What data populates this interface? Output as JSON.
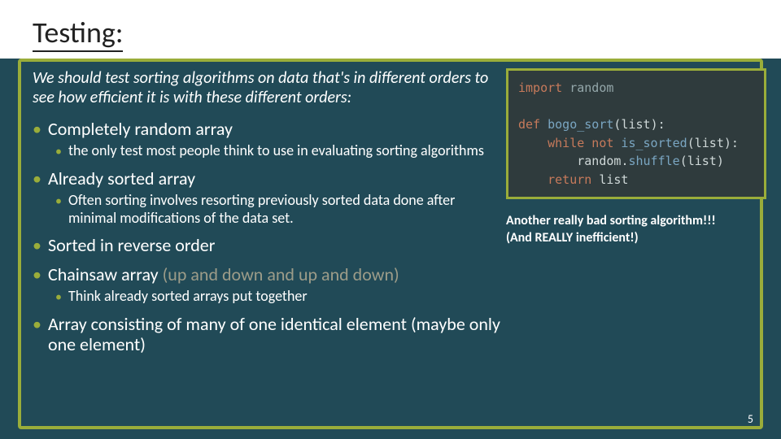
{
  "title": "Testing:",
  "intro": "We should test sorting algorithms on data that's in different orders to see how efficient it is with these different orders:",
  "bullets": [
    {
      "text": "Completely random array",
      "sub": [
        "the only test most people think to use in evaluating sorting algorithms"
      ]
    },
    {
      "text": "Already sorted array",
      "sub": [
        "Often sorting involves resorting previously sorted data done after minimal modifications of the data set."
      ]
    },
    {
      "text": "Sorted in reverse order",
      "sub": []
    },
    {
      "text": "Chainsaw array",
      "suffix": " (up and down and up and down)",
      "sub": [
        "Think already sorted arrays put together"
      ]
    },
    {
      "text": "Array consisting of many of one identical element (maybe only one element)",
      "sub": []
    }
  ],
  "code": {
    "l1a": "import",
    "l1b": " random",
    "l2a": "def",
    "l2b": " bogo_sort",
    "l2c": "(",
    "l2d": "list",
    "l2e": "):",
    "l3a": "    while",
    "l3b": " not",
    "l3c": " is_sorted",
    "l3d": "(list):",
    "l4a": "        random",
    "l4b": ".",
    "l4c": "shuffle",
    "l4d": "(list)",
    "l5a": "    return",
    "l5b": " list"
  },
  "caption_line1": "Another really bad sorting algorithm!!!",
  "caption_line2": "(And REALLY inefficient!)",
  "page_number": "5"
}
